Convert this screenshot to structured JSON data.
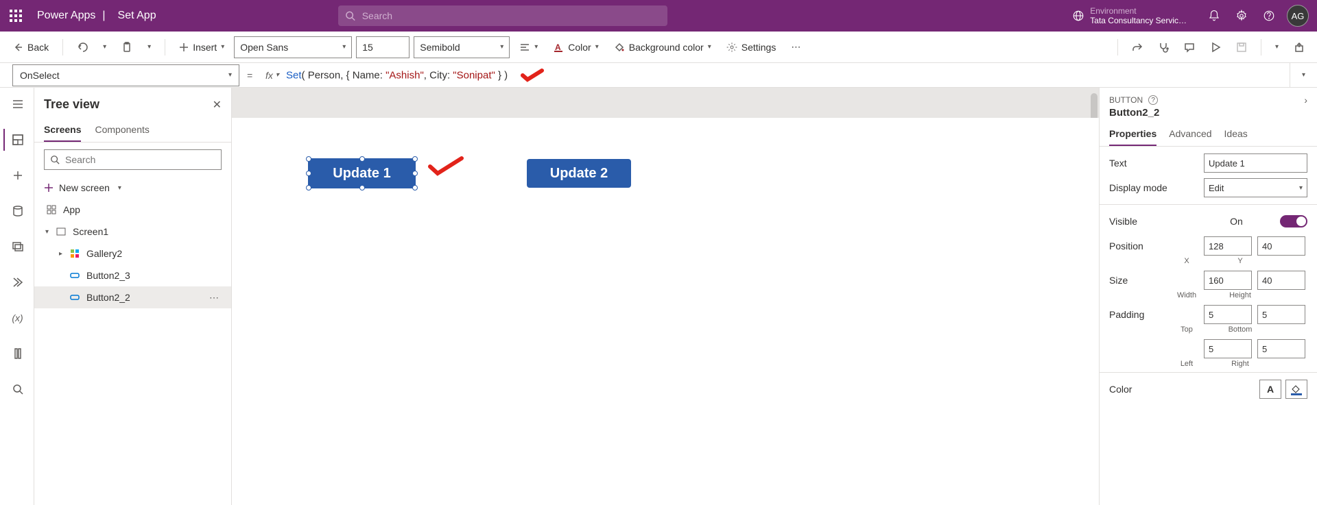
{
  "header": {
    "app_name": "Power Apps",
    "separator": "|",
    "file_name": "Set App",
    "search_placeholder": "Search",
    "env_label": "Environment",
    "env_value": "Tata Consultancy Servic…",
    "avatar": "AG"
  },
  "toolbar": {
    "back": "Back",
    "insert": "Insert",
    "font": "Open Sans",
    "font_size": "15",
    "weight": "Semibold",
    "color": "Color",
    "bgcolor": "Background color",
    "settings": "Settings"
  },
  "formula_bar": {
    "property": "OnSelect",
    "fx_label": "fx",
    "formula_fn": "Set",
    "formula_p1": "Person",
    "formula_k1": "Name:",
    "formula_v1": "\"Ashish\"",
    "formula_k2": "City:",
    "formula_v2": "\"Sonipat\""
  },
  "tree": {
    "title": "Tree view",
    "tab_screens": "Screens",
    "tab_components": "Components",
    "search_placeholder": "Search",
    "new_screen": "New screen",
    "nodes": {
      "app": "App",
      "screen1": "Screen1",
      "gallery2": "Gallery2",
      "button2_3": "Button2_3",
      "button2_2": "Button2_2"
    }
  },
  "canvas": {
    "update1": "Update 1",
    "update2": "Update 2"
  },
  "properties": {
    "type_label": "BUTTON",
    "control_name": "Button2_2",
    "tab_properties": "Properties",
    "tab_advanced": "Advanced",
    "tab_ideas": "Ideas",
    "text_label": "Text",
    "text_value": "Update 1",
    "displaymode_label": "Display mode",
    "displaymode_value": "Edit",
    "visible_label": "Visible",
    "visible_on": "On",
    "position_label": "Position",
    "pos_x": "128",
    "pos_y": "40",
    "lbl_x": "X",
    "lbl_y": "Y",
    "size_label": "Size",
    "size_w": "160",
    "size_h": "40",
    "lbl_w": "Width",
    "lbl_h": "Height",
    "padding_label": "Padding",
    "pad_top": "5",
    "pad_bottom": "5",
    "pad_left": "5",
    "pad_right": "5",
    "lbl_top": "Top",
    "lbl_bottom": "Bottom",
    "lbl_left": "Left",
    "lbl_right": "Right",
    "color_label": "Color",
    "color_letter": "A"
  }
}
